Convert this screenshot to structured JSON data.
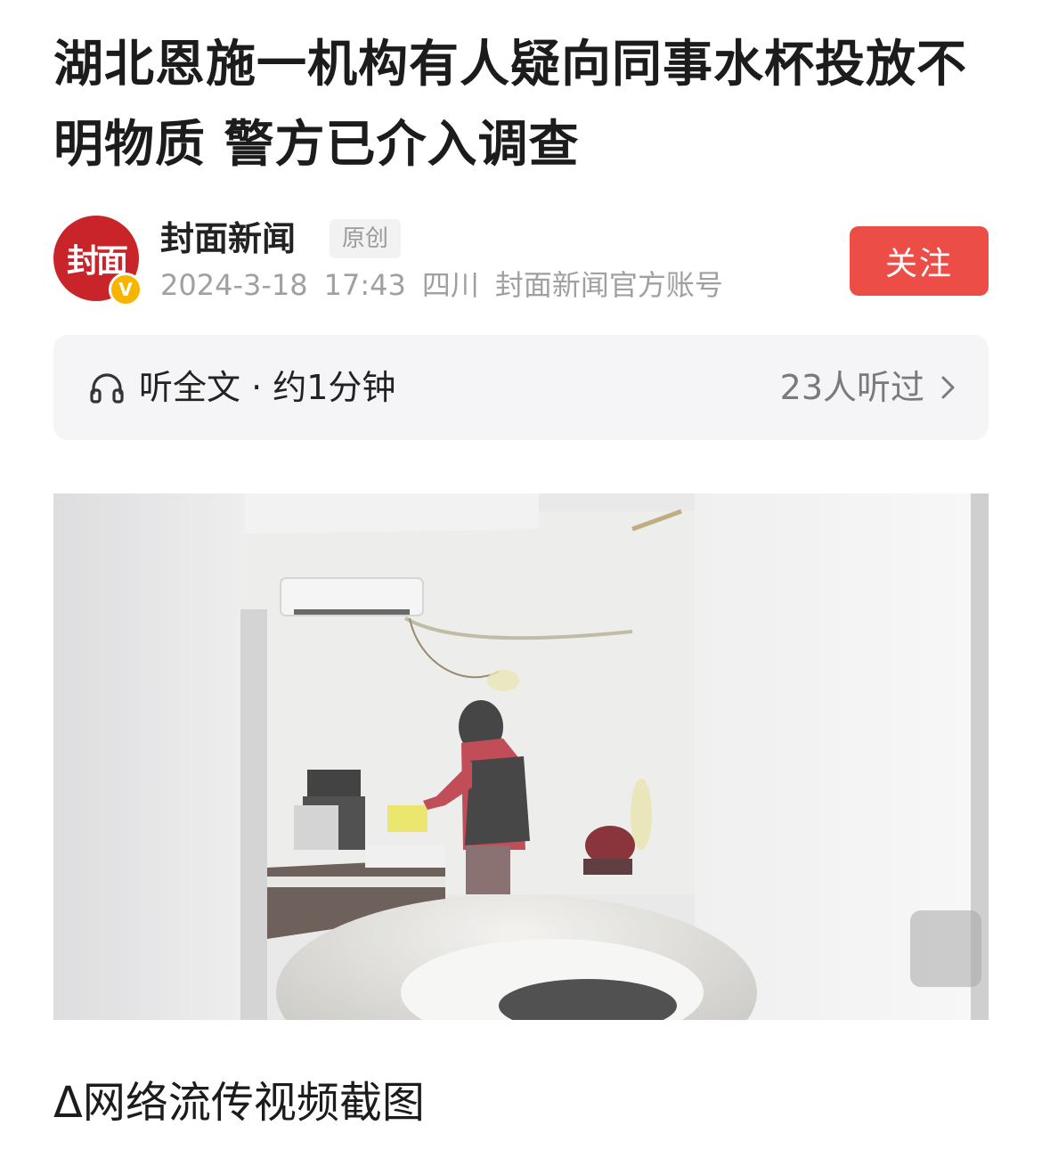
{
  "article": {
    "title": "湖北恩施一机构有人疑向同事水杯投放不明物质 警方已介入调查"
  },
  "author": {
    "avatar_text": "封面",
    "verified_badge": "V",
    "name": "封面新闻",
    "badge": "原创",
    "date": "2024-3-18",
    "time": "17:43",
    "location": "四川",
    "account_desc": "封面新闻官方账号",
    "follow_label": "关注"
  },
  "listen": {
    "label": "听全文 · 约1分钟",
    "count": "23人听过",
    "icon": "headphone-icon",
    "chevron": "chevron-right-icon"
  },
  "photo": {
    "caption": "Δ网络流传视频截图"
  },
  "colors": {
    "follow_bg": "#ec4e47",
    "avatar_bg": "#c8242a",
    "verified": "#f7b500",
    "meta_text": "#a0a0a0",
    "listen_bg": "#f5f5f7"
  }
}
